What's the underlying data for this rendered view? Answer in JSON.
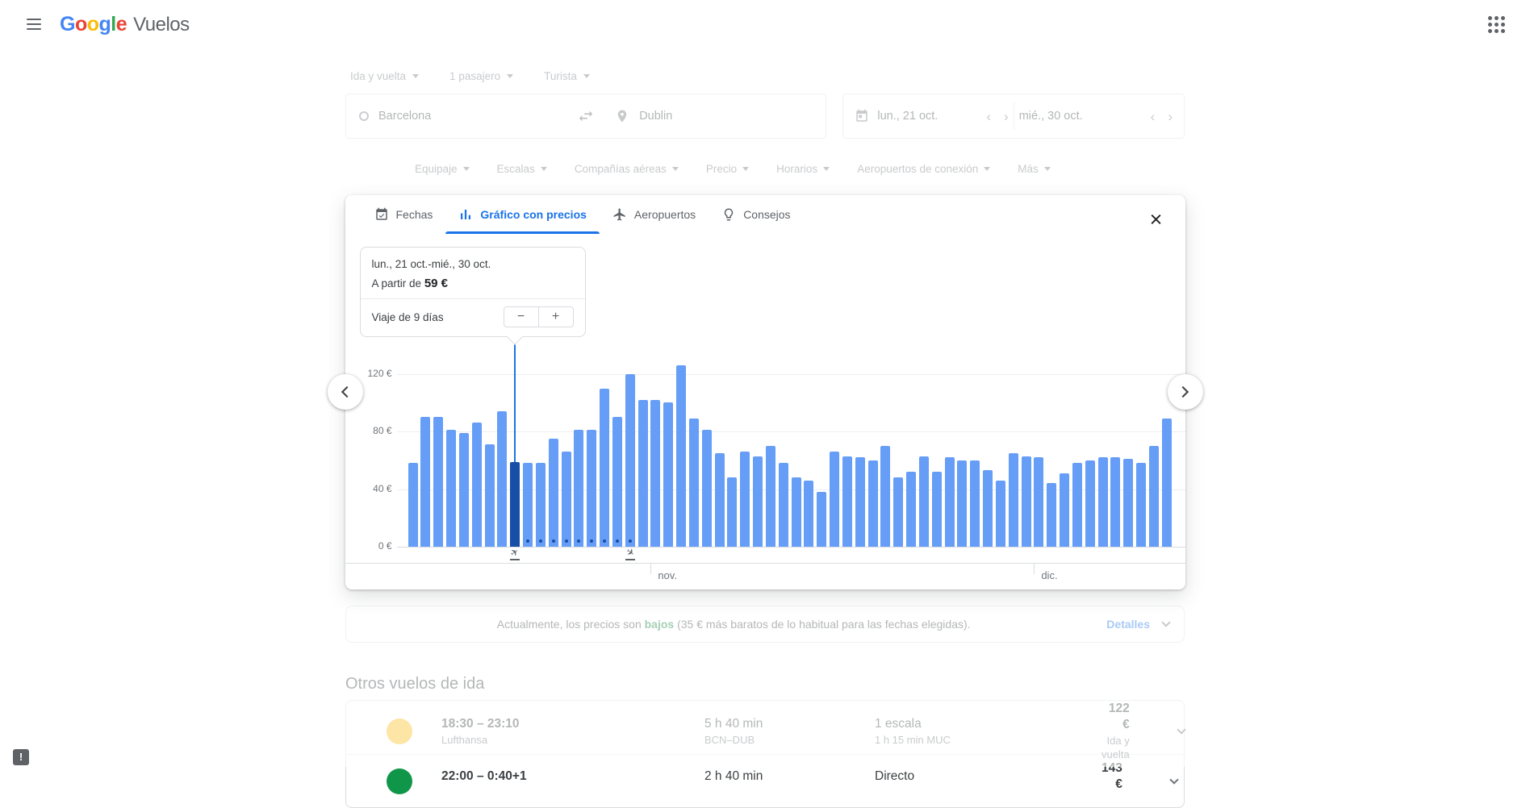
{
  "header": {
    "logo_letters": [
      {
        "ch": "G",
        "color": "#4285F4"
      },
      {
        "ch": "o",
        "color": "#EA4335"
      },
      {
        "ch": "o",
        "color": "#FBBC05"
      },
      {
        "ch": "g",
        "color": "#4285F4"
      },
      {
        "ch": "l",
        "color": "#34A853"
      },
      {
        "ch": "e",
        "color": "#EA4335"
      }
    ],
    "product": "Vuelos"
  },
  "search": {
    "trip_type": "Ida y vuelta",
    "passengers": "1 pasajero",
    "cabin": "Turista",
    "origin": "Barcelona",
    "destination": "Dublin",
    "depart_date": "lun., 21 oct.",
    "return_date": "mié., 30 oct.",
    "filters": [
      "Equipaje",
      "Escalas",
      "Compañías aéreas",
      "Precio",
      "Horarios",
      "Aeropuertos de conexión",
      "Más"
    ]
  },
  "dialog": {
    "tabs": [
      {
        "label": "Fechas",
        "icon": "calendar-check-icon",
        "active": false
      },
      {
        "label": "Gráfico con precios",
        "icon": "bar-chart-icon",
        "active": true
      },
      {
        "label": "Aeropuertos",
        "icon": "plane-icon",
        "active": false
      },
      {
        "label": "Consejos",
        "icon": "lightbulb-icon",
        "active": false
      }
    ],
    "tooltip": {
      "date_range": "lun., 21 oct.-mié., 30 oct.",
      "price_prefix": "A partir de",
      "price": "59 €",
      "trip_length_label": "Viaje de 9 días",
      "minus": "−",
      "plus": "+"
    }
  },
  "chart_data": {
    "type": "bar",
    "title": "Gráfico con precios",
    "unit": "€",
    "values": [
      58,
      90,
      90,
      81,
      79,
      86,
      71,
      94,
      59,
      58,
      58,
      75,
      66,
      81,
      81,
      110,
      90,
      120,
      102,
      102,
      100,
      126,
      89,
      81,
      65,
      48,
      66,
      63,
      70,
      58,
      48,
      46,
      38,
      66,
      63,
      62,
      60,
      70,
      48,
      52,
      63,
      52,
      62,
      60,
      60,
      53,
      46,
      65,
      63,
      62,
      44,
      51,
      58,
      60,
      62,
      62,
      61,
      58,
      70,
      89
    ],
    "selected_index": 8,
    "selected_value": 59,
    "dot_indices": [
      9,
      10,
      11,
      12,
      13,
      14,
      15,
      16,
      17
    ],
    "takeoff_index": 8,
    "landing_index": 17,
    "yticks": [
      {
        "value": 0,
        "label": "0 €"
      },
      {
        "value": 40,
        "label": "40 €"
      },
      {
        "value": 80,
        "label": "80 €"
      },
      {
        "value": 120,
        "label": "120 €"
      }
    ],
    "ylim": [
      0,
      140
    ],
    "grid": true,
    "months": [
      {
        "label": "nov.",
        "index": 19
      },
      {
        "label": "dic.",
        "index": 49
      }
    ],
    "bar_color": "#669df6",
    "selected_color": "#174ea6"
  },
  "price_banner": {
    "prefix": "Actualmente, los precios son ",
    "highlight": "bajos",
    "suffix": " (35 € más baratos de lo habitual para las fechas elegidas).",
    "action": "Detalles"
  },
  "other_flights": {
    "title": "Otros vuelos de ida",
    "rows": [
      {
        "times": "18:30 – 23:10",
        "airline": "Lufthansa",
        "duration": "5 h 40 min",
        "route": "BCN–DUB",
        "stops": "1 escala",
        "stops_detail": "1 h 15 min MUC",
        "price": "122 €",
        "price_note": "Ida y vuelta",
        "logo_color": "#f9ba16"
      },
      {
        "times": "22:00 – 0:40+1",
        "airline": "",
        "duration": "2 h 40 min",
        "route": "",
        "stops": "Directo",
        "stops_detail": "",
        "price": "143 €",
        "price_note": "",
        "logo_color": "#109648"
      }
    ]
  }
}
